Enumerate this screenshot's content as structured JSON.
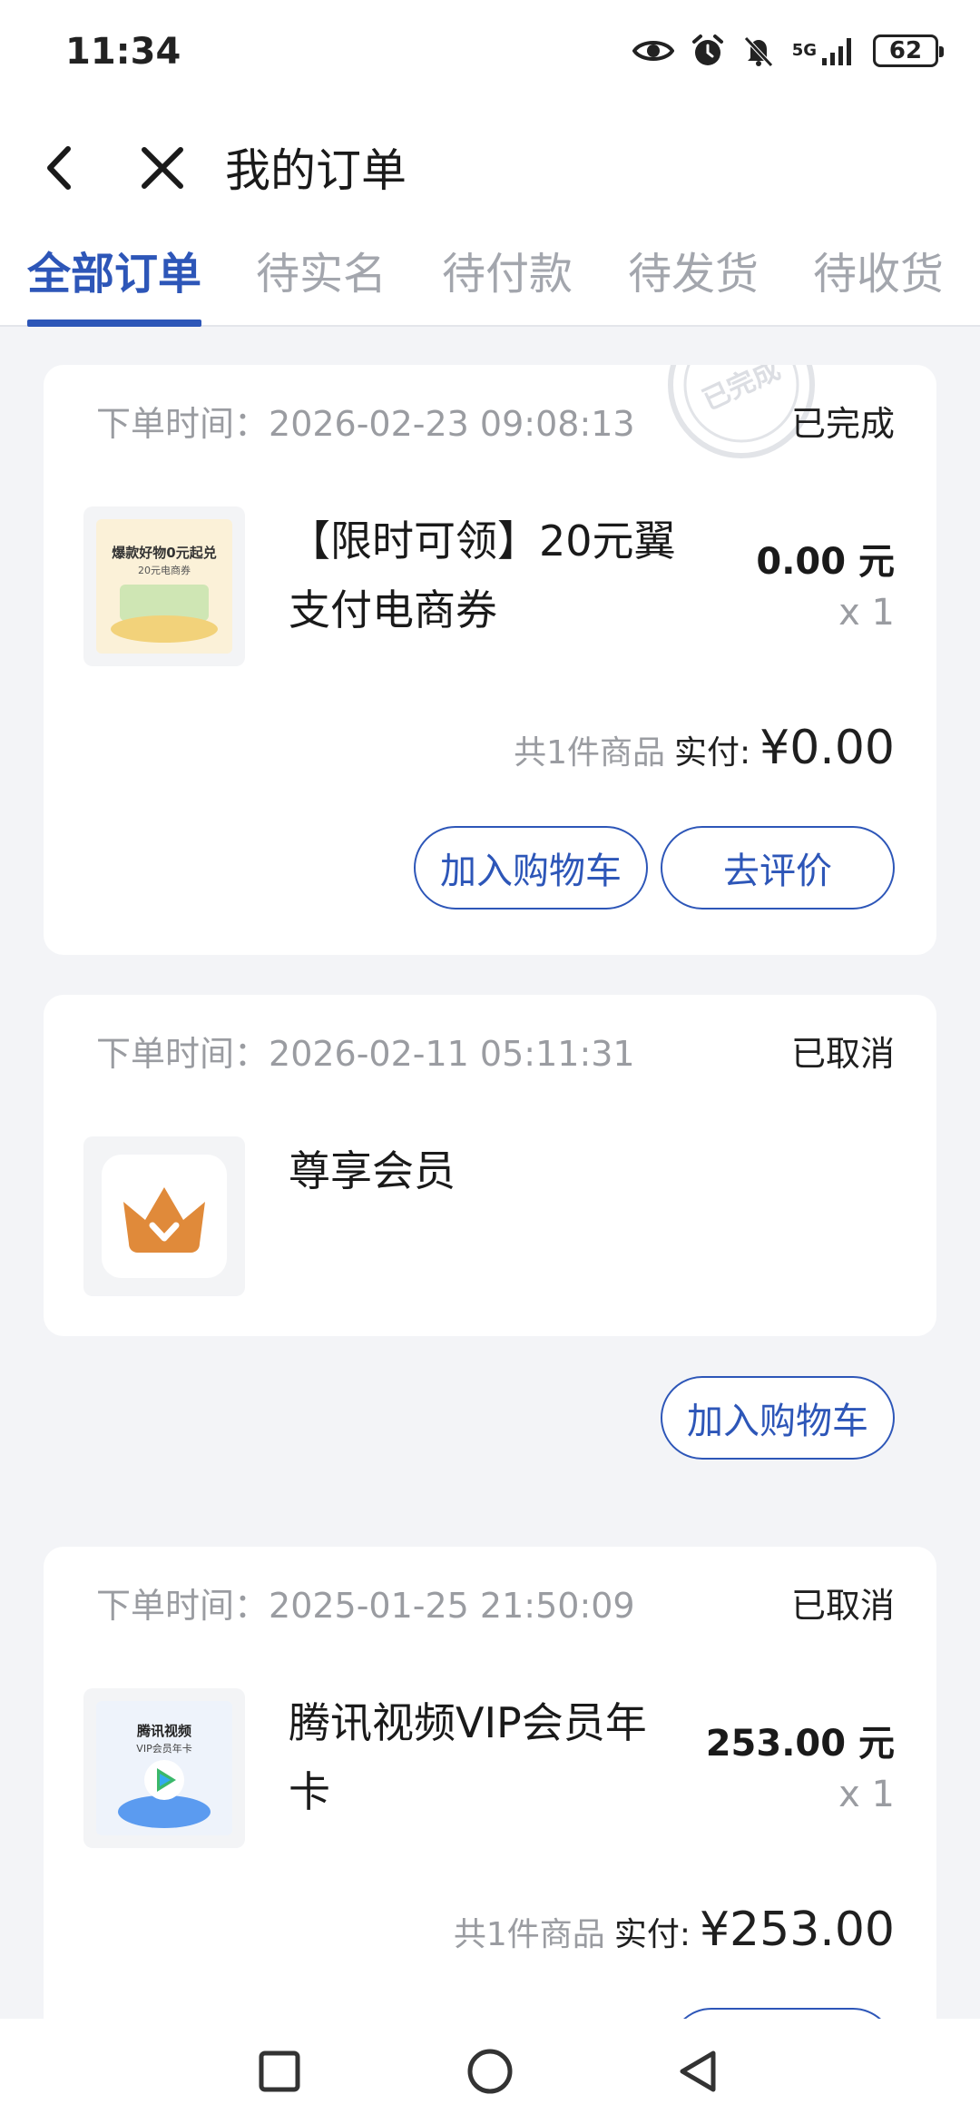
{
  "status_bar": {
    "time": "11:34",
    "network": "5G",
    "battery": "62"
  },
  "header": {
    "title": "我的订单"
  },
  "tabs": [
    {
      "label": "全部订单",
      "active": true
    },
    {
      "label": "待实名",
      "active": false
    },
    {
      "label": "待付款",
      "active": false
    },
    {
      "label": "待发货",
      "active": false
    },
    {
      "label": "待收货",
      "active": false
    }
  ],
  "orders": [
    {
      "time_label": "下单时间：",
      "time": "2026-02-23 09:08:13",
      "status": "已完成",
      "stamp_text": "已完成",
      "product_name": "【限时可领】20元翼支付电商券",
      "thumb_line1": "爆款好物0元起兑",
      "thumb_line2": "20元电商券",
      "unit_price": "0.00 元",
      "quantity": "x 1",
      "count_text": "共1件商品",
      "paid_label": "实付:",
      "total": "¥0.00",
      "buttons": [
        "加入购物车",
        "去评价"
      ]
    },
    {
      "time_label": "下单时间：",
      "time": "2026-02-11 05:11:31",
      "status": "已取消",
      "product_name": "尊享会员",
      "buttons": [
        "加入购物车"
      ]
    },
    {
      "time_label": "下单时间：",
      "time": "2025-01-25 21:50:09",
      "status": "已取消",
      "product_name": "腾讯视频VIP会员年卡",
      "thumb_line1": "腾讯视频",
      "thumb_line2": "VIP会员年卡",
      "unit_price": "253.00 元",
      "quantity": "x 1",
      "count_text": "共1件商品",
      "paid_label": "实付:",
      "total": "¥253.00"
    }
  ],
  "colors": {
    "accent": "#2d56b8",
    "muted": "#9a9ca1",
    "background": "#f3f4f7"
  }
}
